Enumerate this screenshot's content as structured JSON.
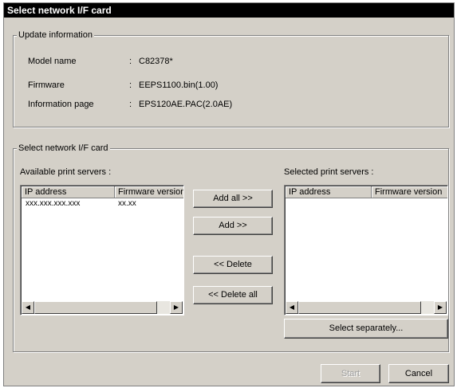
{
  "window": {
    "title": "Select network I/F card"
  },
  "update_info": {
    "legend": "Update information",
    "rows": [
      {
        "label": "Model name",
        "sep": ":",
        "value": "C82378*"
      },
      {
        "label": "Firmware",
        "sep": ":",
        "value": "EEPS1100.bin(1.00)"
      },
      {
        "label": "Information page",
        "sep": ":",
        "value": "EPS120AE.PAC(2.0AE)"
      }
    ]
  },
  "card_select": {
    "legend": "Select network I/F card",
    "available_label": "Available print servers :",
    "selected_label": "Selected print servers :",
    "columns": [
      "IP address",
      "Firmware version"
    ],
    "available_rows": [
      {
        "ip": "xxx.xxx.xxx.xxx",
        "fw": "xx.xx"
      }
    ],
    "selected_rows": [],
    "scroll_left_glyph": "◀",
    "scroll_right_glyph": "▶"
  },
  "buttons": {
    "add_all": "Add all >>",
    "add": "Add >>",
    "delete": "<< Delete",
    "delete_all": "<< Delete all",
    "select_separately": "Select separately...",
    "start": "Start",
    "cancel": "Cancel"
  }
}
